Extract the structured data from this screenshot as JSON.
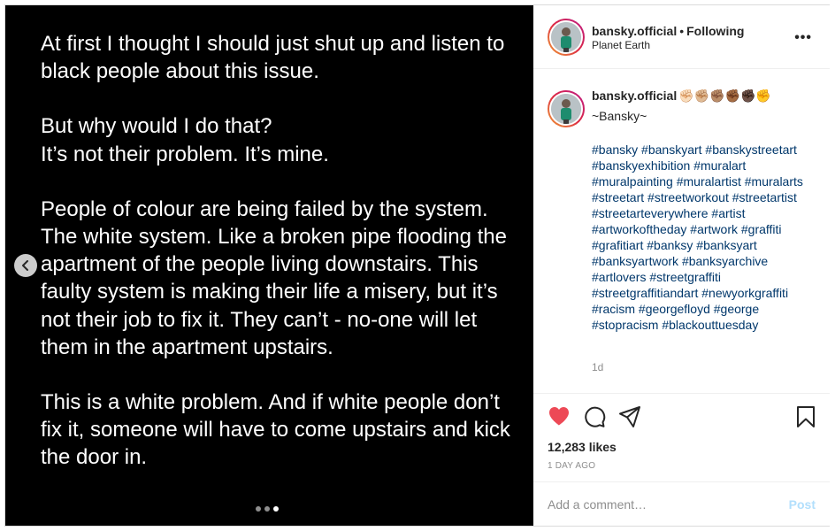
{
  "post": {
    "paragraphs": [
      "At first I thought I should just shut up and listen to black people about this issue.",
      "But why would I do that?\nIt’s not their problem. It’s mine.",
      "People of colour are being failed by the system. The white system. Like a broken pipe flooding the apartment of the people living downstairs. This faulty system is making their life a misery, but it’s not their job to fix it. They can’t - no-one will let them in the apartment upstairs.",
      "This is a white problem. And if white people don’t fix it, someone will have to come upstairs and kick the door in."
    ],
    "carousel": {
      "count": 3,
      "active_index": 2
    }
  },
  "header": {
    "username": "bansky.official",
    "separator": "•",
    "follow_status": "Following",
    "location": "Planet Earth",
    "more_label": "•••"
  },
  "caption": {
    "username": "bansky.official",
    "emojis": "✊🏻✊🏼✊🏽✊🏾✊🏿✊",
    "text": "~Bansky~",
    "hashtags": [
      "#bansky",
      "#banskyart",
      "#banskystreetart",
      "#banskyexhibition",
      "#muralart",
      "#muralpainting",
      "#muralartist",
      "#muralarts",
      "#streetart",
      "#streetworkout",
      "#streetartist",
      "#streetarteverywhere",
      "#artist",
      "#artworkoftheday",
      "#artwork",
      "#graffiti",
      "#grafitiart",
      "#banksy",
      "#banksyart",
      "#banksyartwork",
      "#banksyarchive",
      "#artlovers",
      "#streetgraffiti",
      "#streetgraffitiandart",
      "#newyorkgraffiti",
      "#racism",
      "#georgefloyd",
      "#george",
      "#stopracism",
      "#blackouttuesday"
    ],
    "time": "1d"
  },
  "actions": {
    "likes": "12,283 likes",
    "posted_ago": "1 DAY AGO"
  },
  "comment_box": {
    "placeholder": "Add a comment…",
    "post_label": "Post"
  },
  "colors": {
    "heart": "#ed4956",
    "link": "#00376b",
    "post_button": "#b2dffc"
  },
  "icons": [
    "chevron-left-icon",
    "heart-icon",
    "comment-icon",
    "share-icon",
    "bookmark-icon",
    "more-icon"
  ]
}
